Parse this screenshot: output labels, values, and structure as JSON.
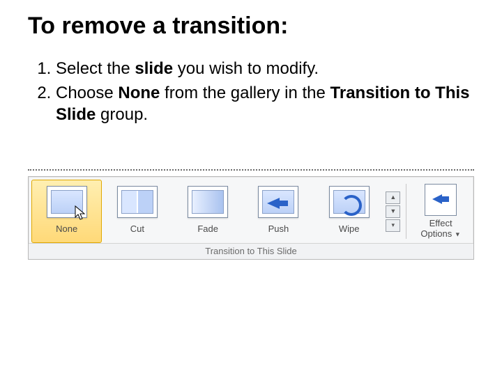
{
  "title": "To remove a transition:",
  "steps": {
    "s1_a": "Select the ",
    "s1_b": "slide",
    "s1_c": " you wish to modify.",
    "s2_a": "Choose ",
    "s2_b": "None",
    "s2_c": " from the gallery in the ",
    "s2_d": "Transition to This Slide",
    "s2_e": " group."
  },
  "gallery": {
    "none": "None",
    "cut": "Cut",
    "fade": "Fade",
    "push": "Push",
    "wipe": "Wipe"
  },
  "effect": {
    "line1": "Effect",
    "line2": "Options"
  },
  "scroll": {
    "up": "▲",
    "down": "▼",
    "more": "▾"
  },
  "group_caption": "Transition to This Slide"
}
